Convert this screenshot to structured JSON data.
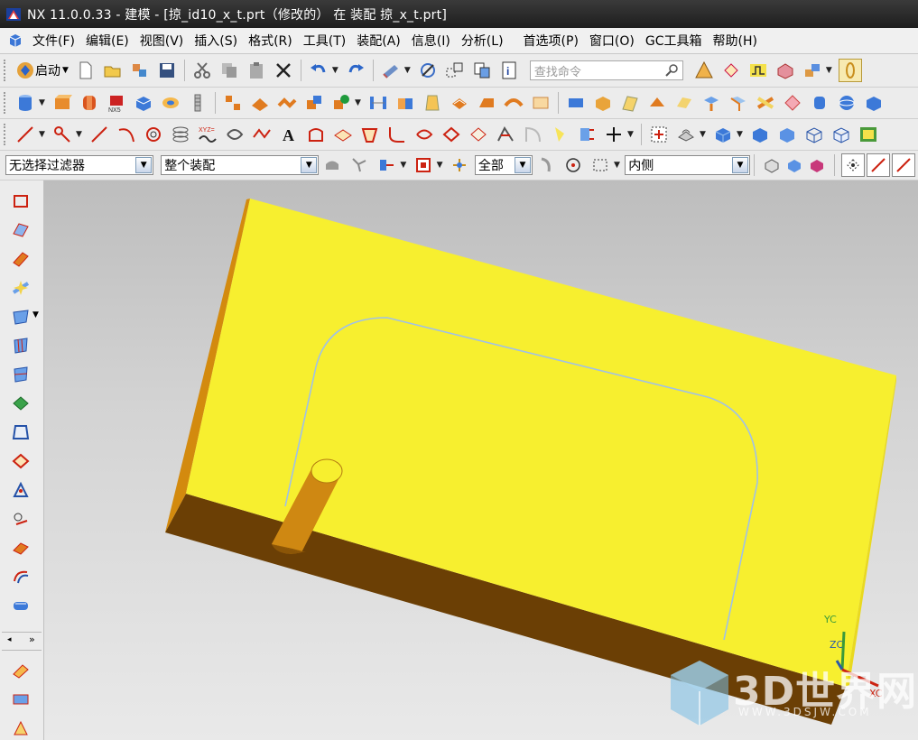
{
  "app": {
    "title": "NX 11.0.0.33 - 建模 - [掠_id10_x_t.prt（修改的） 在 装配 掠_x_t.prt]"
  },
  "menu": {
    "items": [
      "文件(F)",
      "编辑(E)",
      "视图(V)",
      "插入(S)",
      "格式(R)",
      "工具(T)",
      "装配(A)",
      "信息(I)",
      "分析(L)",
      "首选项(P)",
      "窗口(O)",
      "GC工具箱",
      "帮助(H)"
    ]
  },
  "toolbar1": {
    "start_label": "启动",
    "search_placeholder": "查找命令"
  },
  "selection_bar": {
    "filter_value": "无选择过滤器",
    "scope_value": "整个装配",
    "layer_value": "全部",
    "side_value": "内侧"
  },
  "triad": {
    "yc": "YC",
    "zc": "ZC",
    "xc": "XC"
  },
  "watermark": {
    "text": "3D世界网",
    "url": "WWW.3DSJW.COM"
  },
  "colors": {
    "face_top": "#f7ef2f",
    "face_side": "#d38a0e",
    "face_front": "#6b3f05",
    "contour": "#9fc0e8",
    "titlebar": "#2a2a2a"
  }
}
